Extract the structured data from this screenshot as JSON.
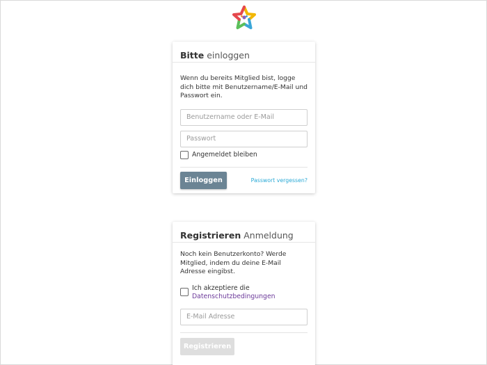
{
  "login": {
    "title_bold": "Bitte",
    "title_light": "einloggen",
    "description": "Wenn du bereits Mitglied bist, logge dich bitte mit Benutzername/E-Mail und Passwort ein.",
    "username_placeholder": "Benutzername oder E-Mail",
    "password_placeholder": "Passwort",
    "remember_label": "Angemeldet bleiben",
    "remember_checked": false,
    "submit_label": "Einloggen",
    "forgot_label": "Passwort vergessen?"
  },
  "register": {
    "title_bold": "Registrieren",
    "title_light": "Anmeldung",
    "description": "Noch kein Benutzerkonto? Werde Mitglied, indem du deine E-Mail Adresse eingibst.",
    "accept_prefix": "Ich akzeptiere die",
    "accept_link": "Datenschutzbedingungen",
    "accept_checked": false,
    "email_placeholder": "E-Mail Adresse",
    "submit_label": "Registrieren"
  },
  "colors": {
    "login_button": "#6b8494",
    "link_blue": "#29a9d6",
    "link_purple": "#6c3a9a",
    "disabled_button": "#dedede"
  },
  "logo": {
    "icon": "star-logo-icon"
  }
}
